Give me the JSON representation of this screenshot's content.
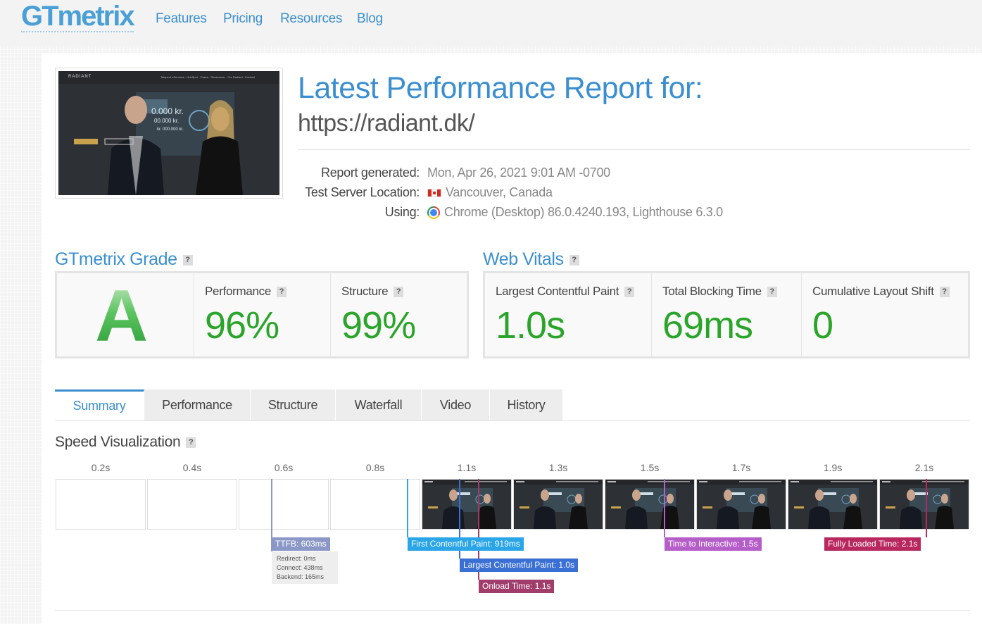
{
  "brand": {
    "logo": "GTmetrix"
  },
  "nav": {
    "items": [
      "Features",
      "Pricing",
      "Resources",
      "Blog"
    ]
  },
  "report": {
    "title": "Latest Performance Report for:",
    "url": "https://radiant.dk/",
    "meta": [
      {
        "label": "Report generated:",
        "value": "Mon, Apr 26, 2021 9:01 AM -0700"
      },
      {
        "label": "Test Server Location:",
        "value": "Vancouver, Canada",
        "icon": "canada-flag-icon"
      },
      {
        "label": "Using:",
        "value": "Chrome (Desktop) 86.0.4240.193, Lighthouse 6.3.0",
        "icon": "chrome-icon"
      }
    ],
    "screenshot": {
      "brand": "RADIANT",
      "menu": "Talquent eServices · HubSpot · Cases · Ressourcer · Om Radiant · Kontakt",
      "amount1": "0.000 kr.",
      "amount2": "00.000 kr.",
      "amount3": "kr.  000.000 kr."
    }
  },
  "grade": {
    "title": "GTmetrix Grade",
    "help": "?",
    "letter": "A",
    "performance_label": "Performance",
    "performance_value": "96%",
    "structure_label": "Structure",
    "structure_value": "99%"
  },
  "vitals": {
    "title": "Web Vitals",
    "help": "?",
    "lcp_label": "Largest Contentful Paint",
    "lcp_value": "1.0s",
    "tbt_label": "Total Blocking Time",
    "tbt_value": "69ms",
    "cls_label": "Cumulative Layout Shift",
    "cls_value": "0"
  },
  "tabs": [
    "Summary",
    "Performance",
    "Structure",
    "Waterfall",
    "Video",
    "History"
  ],
  "active_tab": "Summary",
  "speed_visualization": {
    "title": "Speed Visualization",
    "help": "?",
    "times": [
      "0.2s",
      "0.4s",
      "0.6s",
      "0.8s",
      "1.1s",
      "1.3s",
      "1.5s",
      "1.7s",
      "1.9s",
      "2.1s"
    ],
    "frames_rendered": [
      false,
      false,
      false,
      false,
      true,
      true,
      true,
      true,
      true,
      true
    ],
    "markers": {
      "ttfb": "TTFB: 603ms",
      "fcp": "First Contentful Paint: 919ms",
      "lcp": "Largest Contentful Paint: 1.0s",
      "onload": "Onload Time: 1.1s",
      "tti": "Time to Interactive: 1.5s",
      "fully": "Fully Loaded Time: 2.1s"
    },
    "ttfb_details": {
      "redirect": "Redirect: 0ms",
      "connect": "Connect: 438ms",
      "backend": "Backend: 165ms"
    },
    "colors": {
      "ttfb": "#8b98c7",
      "fcp": "#2aa5e8",
      "lcp": "#3a6fd4",
      "onload": "#a13d6b",
      "tti": "#b55ec9",
      "fully": "#b8285f"
    }
  }
}
